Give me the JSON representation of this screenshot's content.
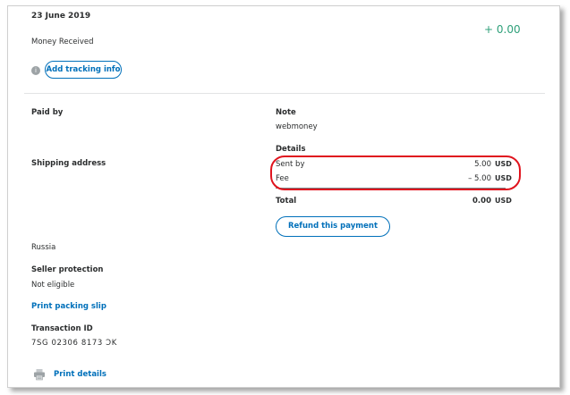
{
  "transaction": {
    "date": "23 June 2019",
    "amount": "+ 0.00",
    "type": "Money Received",
    "tracking_button": "Add tracking info",
    "info_icon": "i"
  },
  "left": {
    "paid_by_label": "Paid by",
    "shipping_address_label": "Shipping address",
    "country": "Russia",
    "seller_protection_label": "Seller protection",
    "seller_protection_value": "Not eligible",
    "print_packing_slip": "Print packing slip",
    "transaction_id_label": "Transaction ID",
    "transaction_id_value": "7SG 02306 8173 ƆK",
    "print_details": "Print details"
  },
  "right": {
    "note_label": "Note",
    "note_value": "webmoney",
    "details_label": "Details",
    "rows": [
      {
        "label": "Sent by",
        "amount": "5.00",
        "currency": "USD"
      },
      {
        "label": "Fee",
        "amount": "– 5.00",
        "currency": "USD"
      }
    ],
    "total_label": "Total",
    "total_amount": "0.00",
    "total_currency": "USD",
    "refund_button": "Refund this payment"
  },
  "colors": {
    "link_blue": "#0070ba",
    "positive_green": "#2fa07a",
    "highlight_red": "#e0141e"
  },
  "icons": {
    "info": "info-icon",
    "printer": "printer-icon"
  }
}
